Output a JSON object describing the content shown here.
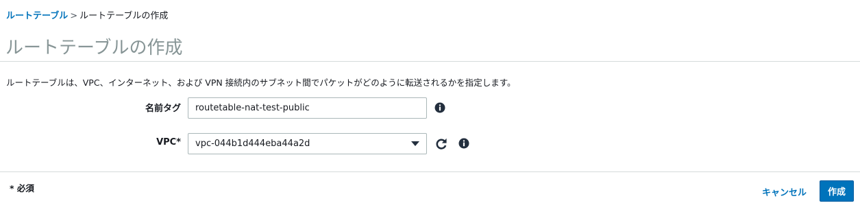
{
  "breadcrumb": {
    "parent": "ルートテーブル",
    "separator": ">",
    "current": "ルートテーブルの作成"
  },
  "page": {
    "title": "ルートテーブルの作成",
    "description": "ルートテーブルは、VPC、インターネット、および VPN 接続内のサブネット間でパケットがどのように転送されるかを指定します。"
  },
  "form": {
    "name_tag": {
      "label": "名前タグ",
      "value": "routetable-nat-test-public",
      "info_icon": "info-icon"
    },
    "vpc": {
      "label": "VPC*",
      "selected": "vpc-044b1d444eba44a2d",
      "refresh_icon": "refresh-icon",
      "info_icon": "info-icon"
    }
  },
  "footer": {
    "required_note": "* 必須",
    "cancel_label": "キャンセル",
    "create_label": "作成"
  },
  "colors": {
    "link": "#0073bb",
    "primary_button": "#0073bb",
    "title": "#879596",
    "icon": "#232f3e",
    "rule": "#d5dbdb"
  }
}
